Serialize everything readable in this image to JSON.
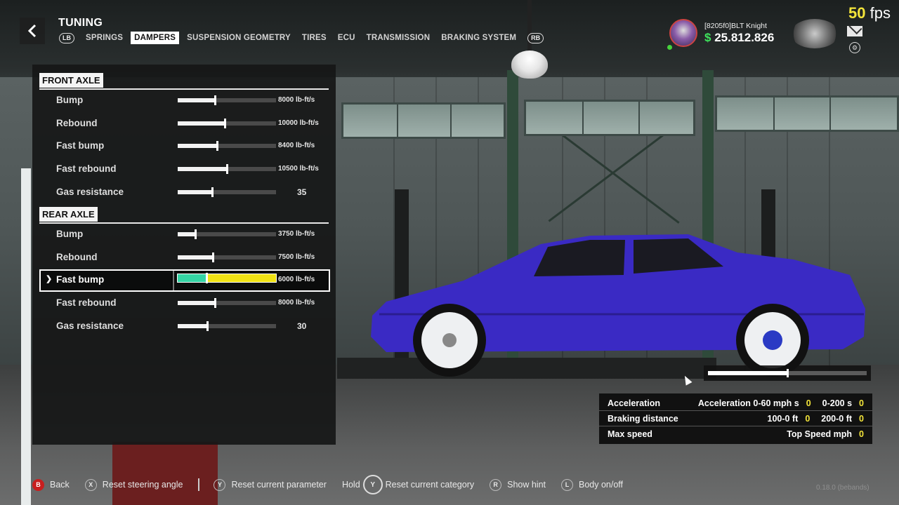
{
  "header": {
    "title": "TUNING",
    "left_bumper": "LB",
    "right_bumper": "RB",
    "tabs": [
      {
        "label": "SPRINGS",
        "active": false
      },
      {
        "label": "DAMPERS",
        "active": true
      },
      {
        "label": "SUSPENSION GEOMETRY",
        "active": false
      },
      {
        "label": "TIRES",
        "active": false
      },
      {
        "label": "ECU",
        "active": false
      },
      {
        "label": "TRANSMISSION",
        "active": false
      },
      {
        "label": "BRAKING SYSTEM",
        "active": false
      }
    ]
  },
  "front_axle": {
    "title": "FRONT AXLE",
    "rows": [
      {
        "label": "Bump",
        "value": "8000 lb-ft/s",
        "level": 0.38
      },
      {
        "label": "Rebound",
        "value": "10000 lb-ft/s",
        "level": 0.48
      },
      {
        "label": "Fast bump",
        "value": "8400 lb-ft/s",
        "level": 0.4
      },
      {
        "label": "Fast rebound",
        "value": "10500 lb-ft/s",
        "level": 0.5
      },
      {
        "label": "Gas resistance",
        "value": "35",
        "level": 0.35
      }
    ]
  },
  "rear_axle": {
    "title": "REAR AXLE",
    "rows": [
      {
        "label": "Bump",
        "value": "3750 lb-ft/s",
        "level": 0.18
      },
      {
        "label": "Rebound",
        "value": "7500 lb-ft/s",
        "level": 0.36
      },
      {
        "label": "Fast bump",
        "value": "6000 lb-ft/s",
        "level": 0.29,
        "selected": true
      },
      {
        "label": "Fast rebound",
        "value": "8000 lb-ft/s",
        "level": 0.38
      },
      {
        "label": "Gas resistance",
        "value": "30",
        "level": 0.3
      }
    ]
  },
  "top_right": {
    "fps_value": "50",
    "fps_unit": "fps",
    "player_name": "[8205f0]BLT Knight",
    "currency_symbol": "$",
    "money": "25.812.826"
  },
  "preview_slider": {
    "level": 0.5
  },
  "stats": {
    "rows": [
      {
        "name": "Acceleration",
        "cells": [
          {
            "label": "Acceleration 0-60 mph s",
            "value": "0"
          },
          {
            "label": "0-200 s",
            "value": "0"
          }
        ]
      },
      {
        "name": "Braking distance",
        "cells": [
          {
            "label": "100-0 ft",
            "value": "0"
          },
          {
            "label": "200-0 ft",
            "value": "0"
          }
        ]
      },
      {
        "name": "Max speed",
        "cells": [
          {
            "label": "Top Speed mph",
            "value": "0"
          }
        ]
      }
    ]
  },
  "footer": {
    "back": {
      "key": "B",
      "label": "Back"
    },
    "reset_steering": {
      "key": "X",
      "label": "Reset steering angle"
    },
    "reset_param": {
      "key": "Y",
      "label": "Reset current parameter"
    },
    "hold_label": "Hold",
    "reset_category": {
      "key": "Y",
      "label": "Reset current category"
    },
    "show_hint": {
      "key": "R",
      "label": "Show hint"
    },
    "body_toggle": {
      "key": "L",
      "label": "Body on/off"
    },
    "version": "0.18.0 (bebands)"
  },
  "colors": {
    "accent_yellow": "#f3e43a",
    "money_green": "#3ee35c",
    "selected_fill": "#35d4a4",
    "selected_track": "#f0e214"
  }
}
